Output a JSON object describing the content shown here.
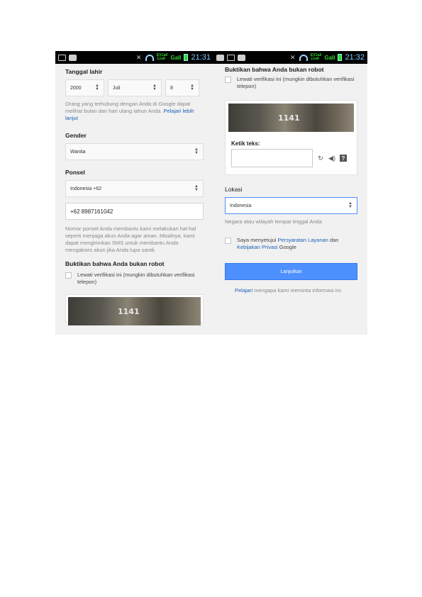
{
  "left": {
    "status": {
      "time": "21:31",
      "net_top": "EVΞall",
      "net_bottom": "ΞΞall",
      "signal": "Gall"
    },
    "birthdate": {
      "label": "Tanggal lahir",
      "year": "2000",
      "month": "Juli",
      "day": "8"
    },
    "birthdate_help": "Orang yang terhubung dengan Anda di Google dapat melihat bulan dan hari ulang tahun Anda.",
    "birthdate_link": "Pelajari lebih lanjut",
    "gender": {
      "label": "Gender",
      "value": "Wanita"
    },
    "phone": {
      "label": "Ponsel",
      "country": "Indonesia +62",
      "value": "+62 8987161042"
    },
    "phone_help": "Nomor ponsel Anda membantu kami melakukan hal-hal seperti menjaga akun Anda agar aman. Misalnya, kami dapat mengirimkan SMS untuk membantu Anda mengakses akun jika Anda lupa sandi.",
    "robot": {
      "label": "Buktikan bahwa Anda bukan robot",
      "skip": "Lewati verifikasi ini (mungkin dibutuhkan verifikasi telepon)"
    },
    "captcha_number": "1141"
  },
  "right": {
    "status": {
      "time": "21:32",
      "net_top": "EVΞall",
      "net_bottom": "ΞΞall",
      "signal": "Gall"
    },
    "robot": {
      "label": "Buktikan bahwa Anda bukan robot",
      "skip": "Lewati verifikasi ini (mungkin dibutuhkan verifikasi telepon)"
    },
    "captcha_number": "1141",
    "captcha_prompt": "Ketik teks:",
    "location": {
      "label": "Lokasi",
      "value": "Indonesia",
      "help": "Negara atau wilayah tempat tinggal Anda"
    },
    "terms": {
      "prefix": "Saya menyetujui ",
      "link1": "Persyaratan Layanan",
      "middle": " dan ",
      "link2": "Kebijakan Privasi",
      "suffix": " Google"
    },
    "continue_label": "Lanjutkan",
    "learn": {
      "link": "Pelajari",
      "text": " mengapa kami meminta informasi ini."
    }
  },
  "colors": {
    "accent": "#4d90fe",
    "link": "#1a5fb4",
    "statusbar": "#000000"
  }
}
